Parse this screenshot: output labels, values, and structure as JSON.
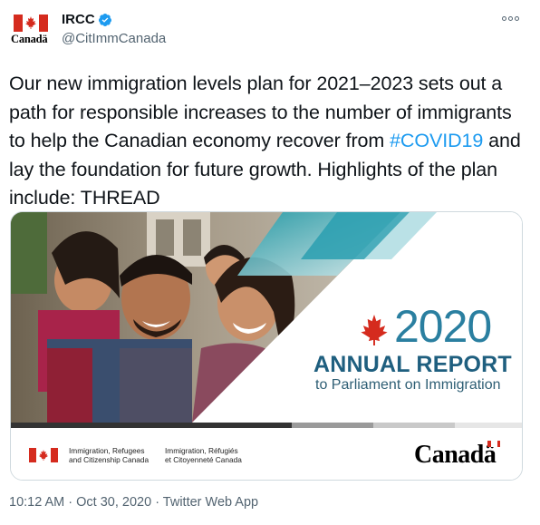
{
  "author": {
    "display_name": "IRCC",
    "handle": "@CitImmCanada",
    "avatar_wordmark": "Canadä",
    "verified_icon": "verified-badge-icon"
  },
  "tweet": {
    "text_before_hashtag": "Our new immigration levels plan for 2021–2023 sets out a path for responsible increases to the number of immigrants to help the Canadian economy recover from ",
    "hashtag": "#COVID19",
    "text_after_hashtag": " and lay the foundation for future growth. Highlights of the plan include: THREAD"
  },
  "media": {
    "report_year": "2020",
    "report_title": "ANNUAL REPORT",
    "report_subtitle": "to Parliament on Immigration",
    "dept_english_line1": "Immigration, Refugees",
    "dept_english_line2": "and Citizenship Canada",
    "dept_french_line1": "Immigration, Réfugiés",
    "dept_french_line2": "et Citoyenneté Canada",
    "canada_wordmark": "Canadä"
  },
  "meta": {
    "timestamp": "10:12 AM · Oct 30, 2020 · Twitter Web App"
  },
  "colors": {
    "link": "#1d9bf0",
    "canada_red": "#d52b1e",
    "report_teal": "#2a7fa0",
    "secondary_text": "#536471"
  }
}
